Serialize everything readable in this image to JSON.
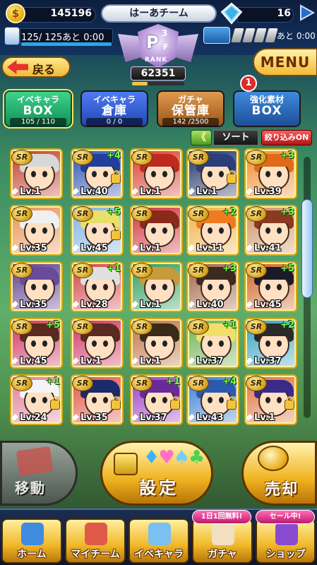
{
  "status": {
    "coins": "145196",
    "team_name": "はーあチーム",
    "gems": "16",
    "stamina": "125/ 125あと  0:00",
    "energy_label": "あと 0:00"
  },
  "rank": {
    "letter": "P",
    "superscript": "3",
    "subscript": "F",
    "label": "RANK",
    "score": "62351"
  },
  "nav_top": {
    "back_label": "戻る",
    "menu_label": "MENU"
  },
  "tabs": [
    {
      "line1": "イベキャラ",
      "line2": "BOX",
      "count": "105 / 110"
    },
    {
      "line1": "イベキャラ",
      "line2": "倉庫",
      "count": "0 / 0"
    },
    {
      "line1": "ガチャ",
      "line2": "保管庫",
      "count": "142 /2500"
    },
    {
      "line1": "強化素材",
      "line2": "BOX",
      "count": ""
    }
  ],
  "material_badge": "1",
  "sort": {
    "chevron": "《",
    "sort_label": "ソート",
    "filter_label": "絞り込みON"
  },
  "grid": {
    "rarity_label": "SR",
    "cards": [
      {
        "lv": "Lv.1",
        "plus": "",
        "lock": false,
        "hair": "#d8d8d8",
        "bg": "#c23a2a"
      },
      {
        "lv": "Lv.40",
        "plus": "+4",
        "lock": true,
        "hair": "#1e3f9c",
        "bg": "#2a4fb0"
      },
      {
        "lv": "Lv.1",
        "plus": "",
        "lock": false,
        "hair": "#c0291e",
        "bg": "#d63b2c"
      },
      {
        "lv": "Lv.1",
        "plus": "",
        "lock": true,
        "hair": "#2b3f7a",
        "bg": "#1b2f66"
      },
      {
        "lv": "Lv.39",
        "plus": "+3",
        "lock": false,
        "hair": "#e06a18",
        "bg": "#f08a2a"
      },
      {
        "lv": "Lv.35",
        "plus": "",
        "lock": false,
        "hair": "#f0f0f0",
        "bg": "#e89050"
      },
      {
        "lv": "Lv.45",
        "plus": "+5",
        "lock": true,
        "hair": "#e8e06a",
        "bg": "#7ab0e0"
      },
      {
        "lv": "Lv.1",
        "plus": "",
        "lock": false,
        "hair": "#8a2a1a",
        "bg": "#d0303a"
      },
      {
        "lv": "Lv.11",
        "plus": "+2",
        "lock": false,
        "hair": "#f07a20",
        "bg": "#f0b040"
      },
      {
        "lv": "Lv.41",
        "plus": "+3",
        "lock": false,
        "hair": "#8a3a20",
        "bg": "#d09060"
      },
      {
        "lv": "Lv.35",
        "plus": "",
        "lock": false,
        "hair": "#6a4a9a",
        "bg": "#5a3a8a"
      },
      {
        "lv": "Lv.28",
        "plus": "+1",
        "lock": false,
        "hair": "#e0e0e0",
        "bg": "#d04040"
      },
      {
        "lv": "Lv.1",
        "plus": "",
        "lock": false,
        "hair": "#c89a3a",
        "bg": "#2a9a5a"
      },
      {
        "lv": "Lv.40",
        "plus": "+3",
        "lock": false,
        "hair": "#3a2a20",
        "bg": "#a06040"
      },
      {
        "lv": "Lv.45",
        "plus": "+5",
        "lock": false,
        "hair": "#1a1a2a",
        "bg": "#d06020"
      },
      {
        "lv": "Lv.45",
        "plus": "+5",
        "lock": false,
        "hair": "#5a2a20",
        "bg": "#d03060"
      },
      {
        "lv": "Lv.1",
        "plus": "",
        "lock": false,
        "hair": "#5a2a20",
        "bg": "#d03060"
      },
      {
        "lv": "Lv.1",
        "plus": "",
        "lock": false,
        "hair": "#3a2a1a",
        "bg": "#c07040"
      },
      {
        "lv": "Lv.37",
        "plus": "+1",
        "lock": false,
        "hair": "#f0e06a",
        "bg": "#6ab04a"
      },
      {
        "lv": "Lv.37",
        "plus": "+2",
        "lock": false,
        "hair": "#2a2a2a",
        "bg": "#30a0c0"
      },
      {
        "lv": "Lv.24",
        "plus": "+1",
        "lock": true,
        "hair": "#f4f4f4",
        "bg": "#e07a9a"
      },
      {
        "lv": "Lv.35",
        "plus": "",
        "lock": true,
        "hair": "#1a2a6a",
        "bg": "#e05040"
      },
      {
        "lv": "Lv.37",
        "plus": "+1",
        "lock": true,
        "hair": "#6a2a9a",
        "bg": "#9a3ac0"
      },
      {
        "lv": "Lv.43",
        "plus": "+4",
        "lock": true,
        "hair": "#2a5ab0",
        "bg": "#3a7ad0"
      },
      {
        "lv": "Lv.1",
        "plus": "",
        "lock": true,
        "hair": "#3a2a8a",
        "bg": "#e0703a"
      }
    ]
  },
  "actions": {
    "move_label": "移動",
    "settings_label": "設定",
    "settings_suits": "♦♥♠♣",
    "sell_label": "売却"
  },
  "bottom_nav": [
    {
      "label": "ホーム"
    },
    {
      "label": "マイチーム"
    },
    {
      "label": "イベキャラ"
    },
    {
      "label": "ガチャ"
    },
    {
      "label": "ショップ"
    }
  ],
  "promos": {
    "free_label": "1日1回無料!",
    "sale_label": "セール中!"
  },
  "colors": {
    "accent_gold": "#f0b828",
    "tab_active": "#129057",
    "filter_red": "#b01515"
  }
}
